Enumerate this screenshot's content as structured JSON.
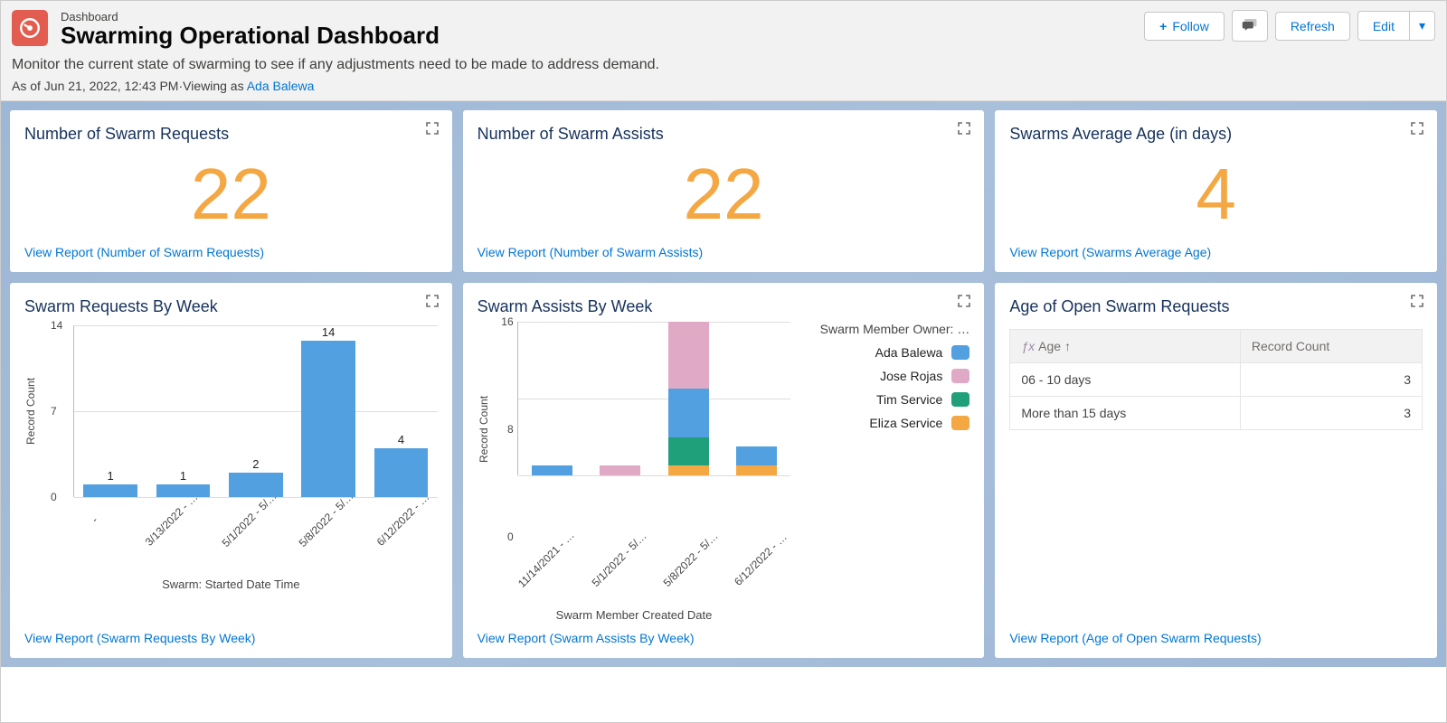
{
  "header": {
    "crumb": "Dashboard",
    "title": "Swarming Operational Dashboard",
    "subtitle": "Monitor the current state of swarming to see if any adjustments need to be made to address demand.",
    "as_of_prefix": "As of ",
    "as_of_value": "Jun 21, 2022, 12:43 PM",
    "viewing_as_prefix": "·Viewing as ",
    "viewing_as_user": "Ada Balewa",
    "actions": {
      "follow": "Follow",
      "refresh": "Refresh",
      "edit": "Edit"
    }
  },
  "cards": {
    "swarm_requests": {
      "title": "Number of Swarm Requests",
      "value": "22",
      "link": "View Report (Number of Swarm Requests)"
    },
    "swarm_assists": {
      "title": "Number of Swarm Assists",
      "value": "22",
      "link": "View Report (Number of Swarm Assists)"
    },
    "avg_age": {
      "title": "Swarms Average Age (in days)",
      "value": "4",
      "link": "View Report (Swarms Average Age)"
    },
    "requests_by_week": {
      "title": "Swarm Requests By Week",
      "y_label": "Record Count",
      "x_label": "Swarm: Started Date Time",
      "link": "View Report (Swarm Requests By Week)"
    },
    "assists_by_week": {
      "title": "Swarm Assists By Week",
      "y_label": "Record Count",
      "x_label": "Swarm Member Created Date",
      "legend_title": "Swarm Member Owner: …",
      "link": "View Report (Swarm Assists By Week)"
    },
    "age_open": {
      "title": "Age of Open Swarm Requests",
      "col_age": "Age",
      "col_count": "Record Count",
      "rows": [
        {
          "age": "06 - 10 days",
          "count": "3"
        },
        {
          "age": "More than 15 days",
          "count": "3"
        }
      ],
      "link": "View Report (Age of Open Swarm Requests)"
    }
  },
  "chart_data": [
    {
      "id": "requests_by_week",
      "type": "bar",
      "title": "Swarm Requests By Week",
      "xlabel": "Swarm: Started Date Time",
      "ylabel": "Record Count",
      "ylim": [
        0,
        14
      ],
      "y_ticks": [
        0,
        7,
        14
      ],
      "categories": [
        "-",
        "3/13/2022 - …",
        "5/1/2022 - 5/…",
        "5/8/2022 - 5/…",
        "6/12/2022 - …"
      ],
      "values": [
        1,
        1,
        2,
        14,
        4
      ]
    },
    {
      "id": "assists_by_week",
      "type": "bar_stacked",
      "title": "Swarm Assists By Week",
      "xlabel": "Swarm Member Created Date",
      "ylabel": "Record Count",
      "ylim": [
        0,
        16
      ],
      "y_ticks": [
        0,
        8,
        16
      ],
      "categories": [
        "11/14/2021 - …",
        "5/1/2022 - 5/…",
        "5/8/2022 - 5/…",
        "6/12/2022 - …"
      ],
      "legend_title": "Swarm Member Owner: …",
      "series": [
        {
          "name": "Ada Balewa",
          "color": "#52a0e0",
          "values": [
            1,
            0,
            5,
            2
          ]
        },
        {
          "name": "Jose Rojas",
          "color": "#e0a9c5",
          "values": [
            0,
            1,
            7,
            0
          ]
        },
        {
          "name": "Tim Service",
          "color": "#20a07a",
          "values": [
            0,
            0,
            3,
            0
          ]
        },
        {
          "name": "Eliza Service",
          "color": "#f4a844",
          "values": [
            0,
            0,
            1,
            1
          ]
        }
      ]
    }
  ],
  "icons": {
    "plus": "+",
    "chevron_down": "▾",
    "sort_up": "↑"
  }
}
